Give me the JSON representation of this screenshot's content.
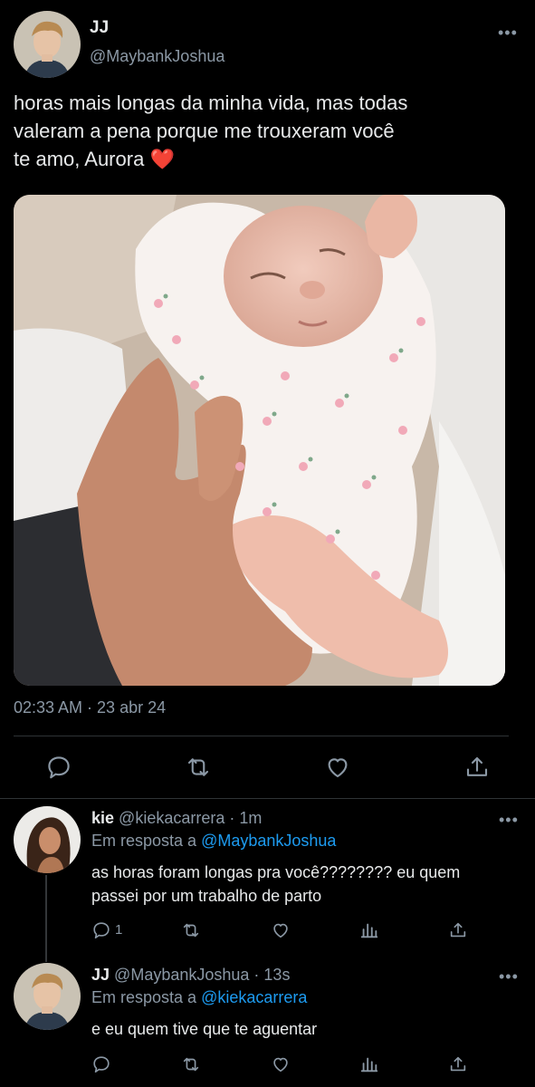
{
  "main_tweet": {
    "name": "JJ",
    "handle": "@MaybankJoshua",
    "text_line1": "horas mais longas da minha vida, mas todas",
    "text_line2": "valeram a pena porque me trouxeram você",
    "text_line3": "te amo, Aurora",
    "heart_emoji": "❤️",
    "timestamp": "02:33 AM · 23 abr 24",
    "actions": [
      "reply-icon",
      "retweet-icon",
      "like-icon",
      "share-icon"
    ]
  },
  "replies": [
    {
      "name": "kie",
      "handle": "@kiekacarrera",
      "time": "· 1m",
      "replying_to_label": "Em resposta a",
      "replying_to": "@MaybankJoshua",
      "text_line1": "as horas foram longas pra você???????? eu quem",
      "text_line2": "passei por um trabalho de parto",
      "reply_count": "1",
      "actions": [
        "reply-icon",
        "retweet-icon",
        "like-icon",
        "analytics-icon",
        "share-icon"
      ]
    },
    {
      "name": "JJ",
      "handle": "@MaybankJoshua",
      "time": "· 13s",
      "replying_to_label": "Em resposta a",
      "replying_to": "@kiekacarrera",
      "text_line1": "e eu quem tive que te aguentar",
      "actions": [
        "reply-icon",
        "retweet-icon",
        "like-icon",
        "analytics-icon",
        "share-icon"
      ]
    }
  ],
  "more_dots": "•••",
  "colors": {
    "background": "#000000",
    "text": "#e7e9ea",
    "secondary": "#8b98a5",
    "link": "#1d9bf0",
    "divider": "#2f3336",
    "heart": "#f4212e"
  }
}
